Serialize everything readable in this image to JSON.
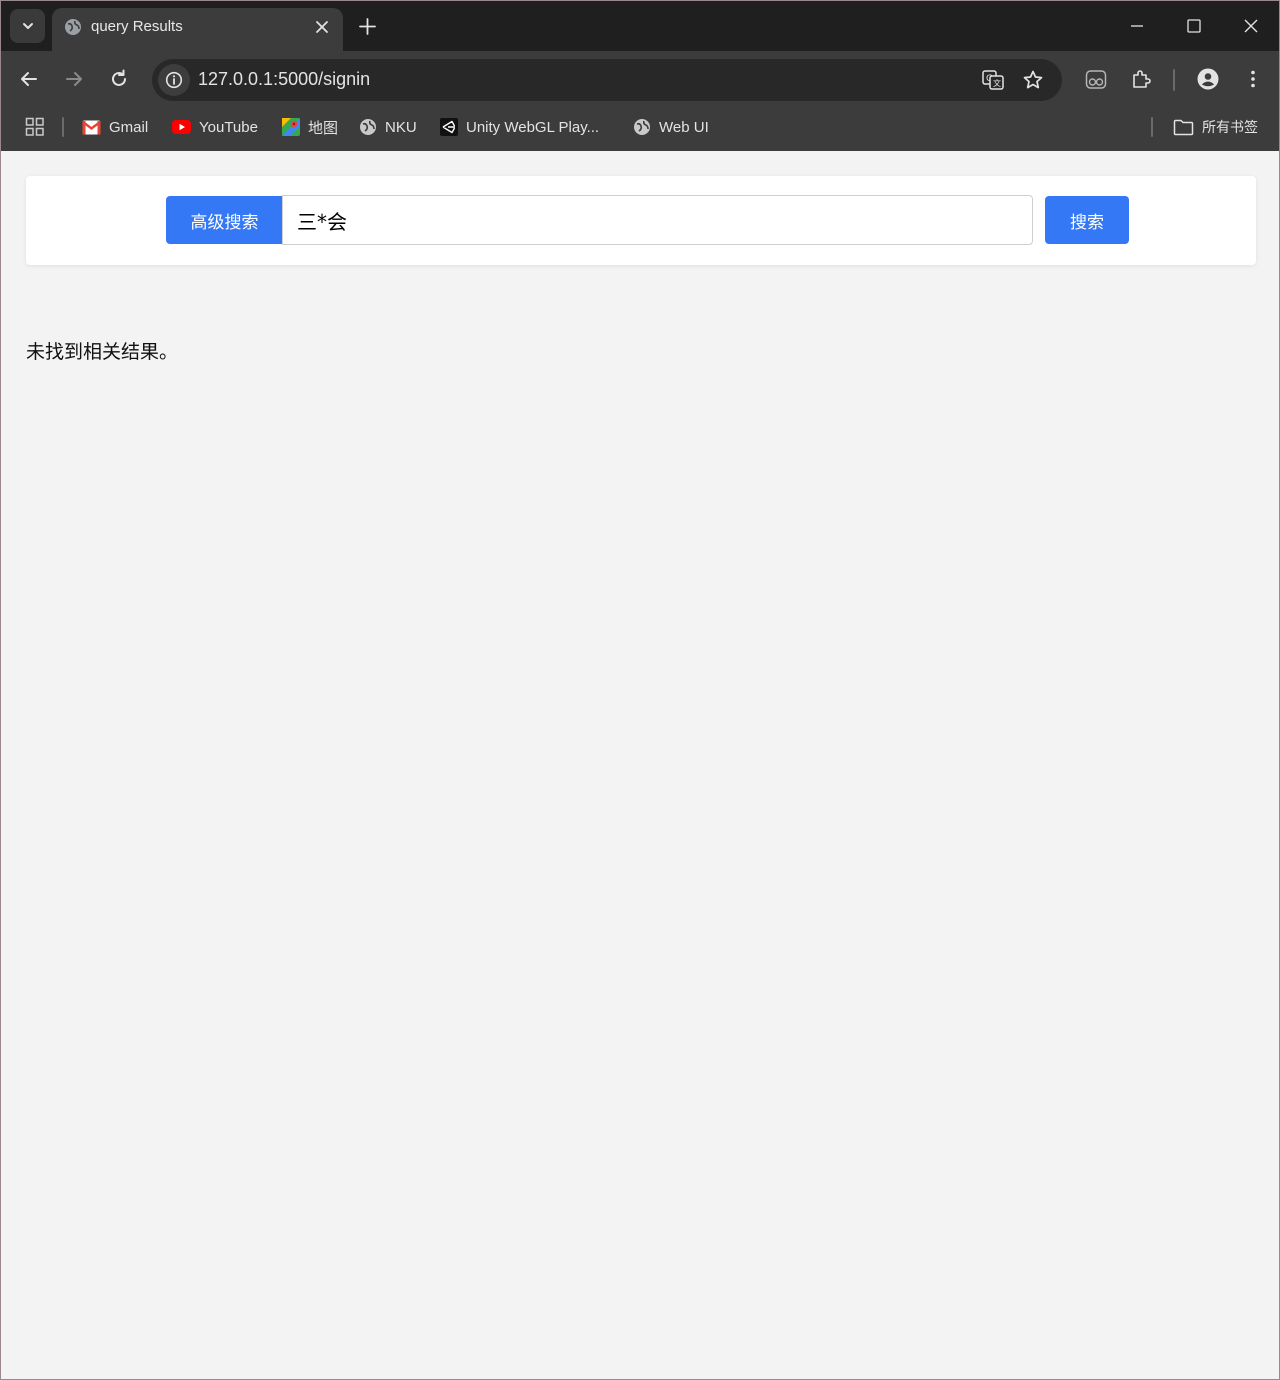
{
  "browser": {
    "tab_title": "query Results",
    "url": "127.0.0.1:5000/signin"
  },
  "bookmarks": [
    {
      "label": "Gmail",
      "icon": "gmail-icon"
    },
    {
      "label": "YouTube",
      "icon": "youtube-icon"
    },
    {
      "label": "地图",
      "icon": "maps-icon"
    },
    {
      "label": "NKU",
      "icon": "globe-icon"
    },
    {
      "label": "Unity WebGL Play...",
      "icon": "unity-icon"
    },
    {
      "label": "Web UI",
      "icon": "globe-icon"
    }
  ],
  "all_bookmarks_label": "所有书签",
  "search": {
    "advanced_label": "高级搜索",
    "query": "三*会",
    "submit_label": "搜索"
  },
  "results": {
    "message": "未找到相关结果。"
  },
  "colors": {
    "accent": "#3478f6",
    "page_bg": "#f3f3f3",
    "chrome_dark": "#1f1f1f",
    "chrome_toolbar": "#3c3c3c"
  }
}
